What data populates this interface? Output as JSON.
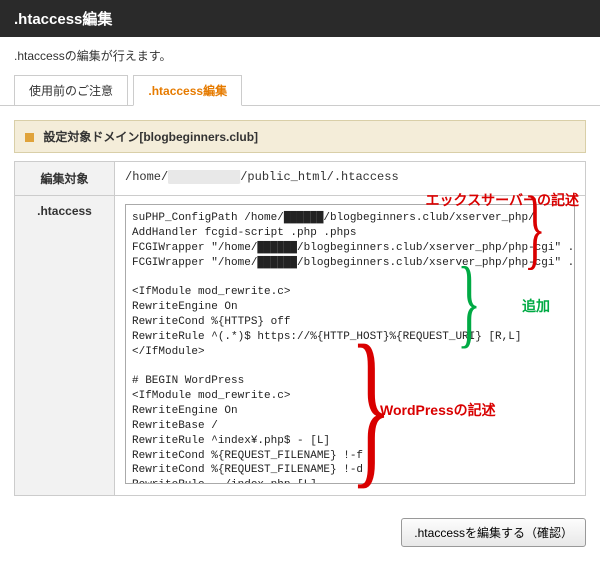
{
  "header": {
    "title": ".htaccess編集"
  },
  "description": ".htaccessの編集が行えます。",
  "tabs": {
    "notice": "使用前のご注意",
    "edit": ".htaccess編集"
  },
  "domain": {
    "label_prefix": "設定対象ドメイン",
    "domain": "[blogbeginners.club]"
  },
  "row_labels": {
    "target": "編集対象",
    "htaccess": ".htaccess"
  },
  "path": {
    "prefix": "/home/",
    "redacted": "██████████",
    "suffix": "/public_html/.htaccess"
  },
  "code": "suPHP_ConfigPath /home/██████/blogbeginners.club/xserver_php/\nAddHandler fcgid-script .php .phps\nFCGIWrapper \"/home/██████/blogbeginners.club/xserver_php/php-cgi\" .php\nFCGIWrapper \"/home/██████/blogbeginners.club/xserver_php/php-cgi\" .phps\n\n<IfModule mod_rewrite.c>\nRewriteEngine On\nRewriteCond %{HTTPS} off\nRewriteRule ^(.*)$ https://%{HTTP_HOST}%{REQUEST_URI} [R,L]\n</IfModule>\n\n# BEGIN WordPress\n<IfModule mod_rewrite.c>\nRewriteEngine On\nRewriteBase /\nRewriteRule ^index¥.php$ - [L]\nRewriteCond %{REQUEST_FILENAME} !-f\nRewriteCond %{REQUEST_FILENAME} !-d\nRewriteRule . /index.php [L]\n</IfModule>\n# END WordPress",
  "annotations": {
    "xserver": "エックスサーバーの記述",
    "added": "追加",
    "wordpress": "WordPressの記述"
  },
  "footer": {
    "button": ".htaccessを編集する（確認）"
  }
}
